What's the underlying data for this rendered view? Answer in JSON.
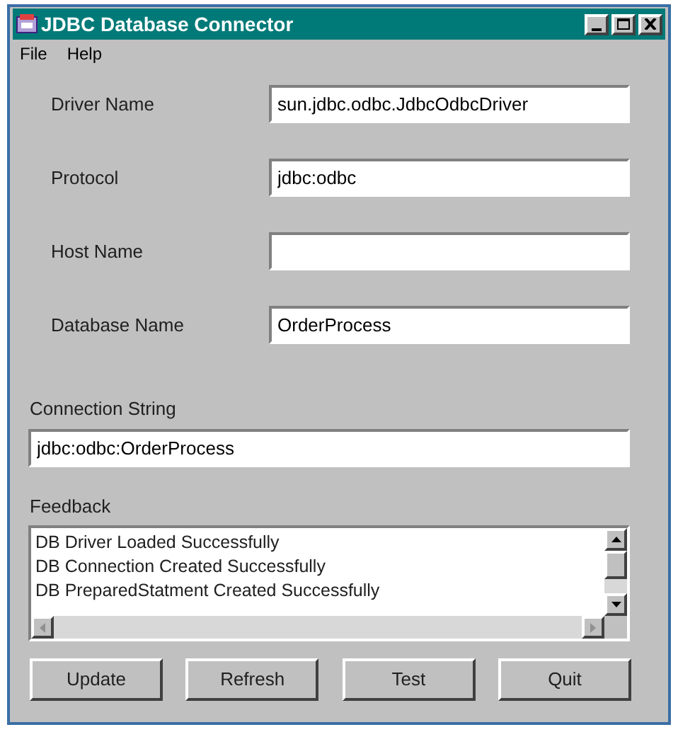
{
  "window": {
    "title": "JDBC Database Connector"
  },
  "menu": [
    "File",
    "Help"
  ],
  "fields": [
    {
      "label": "Driver Name",
      "value": "sun.jdbc.odbc.JdbcOdbcDriver"
    },
    {
      "label": "Protocol",
      "value": "jdbc:odbc"
    },
    {
      "label": "Host Name"
    },
    {
      "label": "Database Name",
      "value": "OrderProcess"
    }
  ],
  "connection_string": {
    "label": "Connection String",
    "value": "jdbc:odbc:OrderProcess"
  },
  "feedback": {
    "label": "Feedback",
    "lines": [
      "DB Driver Loaded Successfully",
      "DB Connection Created Successfully",
      "DB PreparedStatment Created Successfully"
    ]
  },
  "buttons": [
    "Update",
    "Refresh",
    "Test",
    "Quit"
  ]
}
